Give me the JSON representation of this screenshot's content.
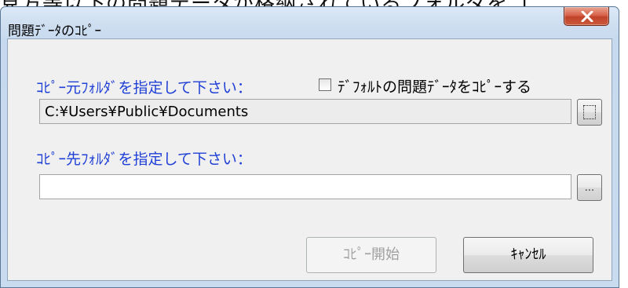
{
  "background": {
    "cropped_text": "見方等以下の問題データが格納されているフォルダをコ"
  },
  "window": {
    "title": "問題ﾃﾞｰﾀのｺﾋﾟｰ",
    "close_icon": "close-x-icon"
  },
  "source": {
    "label": "ｺﾋﾟｰ元ﾌｫﾙﾀﾞを指定して下さい：",
    "checkbox_label": "ﾃﾞﾌｫﾙﾄの問題ﾃﾞｰﾀをｺﾋﾟｰする",
    "checkbox_checked": false,
    "path_value": "C:¥Users¥Public¥Documents"
  },
  "destination": {
    "label": "ｺﾋﾟｰ先ﾌｫﾙﾀﾞを指定して下さい：",
    "path_value": "",
    "browse_label": "..."
  },
  "buttons": {
    "start_label": "ｺﾋﾟｰ開始",
    "start_enabled": false,
    "cancel_label": "ｷｬﾝｾﾙ"
  },
  "colors": {
    "label_blue": "#1f3fd6",
    "close_red": "#c0432a",
    "frame_blue": "#c6d9ee"
  }
}
